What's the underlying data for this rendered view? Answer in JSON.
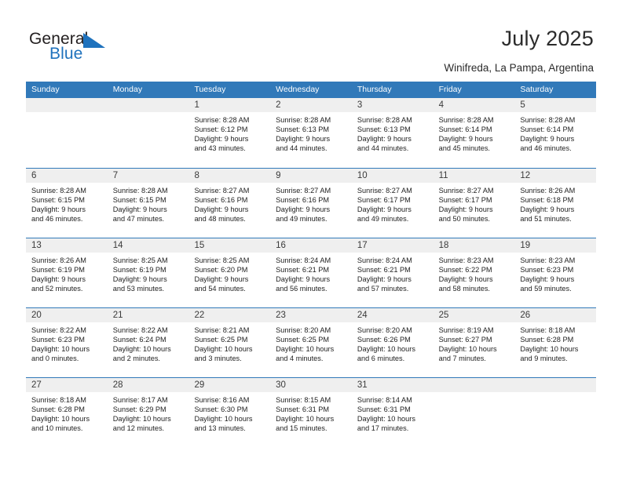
{
  "brand": {
    "name_part1": "General",
    "name_part2": "Blue",
    "flag_icon": "blue-triangle-flag-icon",
    "accent_color": "#1f72bd"
  },
  "header": {
    "title": "July 2025",
    "subtitle": "Winifreda, La Pampa, Argentina"
  },
  "theme": {
    "header_blue": "#3179b9",
    "day_band_gray": "#efefef",
    "text": "#222222"
  },
  "weekdays": [
    "Sunday",
    "Monday",
    "Tuesday",
    "Wednesday",
    "Thursday",
    "Friday",
    "Saturday"
  ],
  "weeks": [
    [
      {
        "day": "",
        "lines": []
      },
      {
        "day": "",
        "lines": []
      },
      {
        "day": "1",
        "lines": [
          "Sunrise: 8:28 AM",
          "Sunset: 6:12 PM",
          "Daylight: 9 hours",
          "and 43 minutes."
        ]
      },
      {
        "day": "2",
        "lines": [
          "Sunrise: 8:28 AM",
          "Sunset: 6:13 PM",
          "Daylight: 9 hours",
          "and 44 minutes."
        ]
      },
      {
        "day": "3",
        "lines": [
          "Sunrise: 8:28 AM",
          "Sunset: 6:13 PM",
          "Daylight: 9 hours",
          "and 44 minutes."
        ]
      },
      {
        "day": "4",
        "lines": [
          "Sunrise: 8:28 AM",
          "Sunset: 6:14 PM",
          "Daylight: 9 hours",
          "and 45 minutes."
        ]
      },
      {
        "day": "5",
        "lines": [
          "Sunrise: 8:28 AM",
          "Sunset: 6:14 PM",
          "Daylight: 9 hours",
          "and 46 minutes."
        ]
      }
    ],
    [
      {
        "day": "6",
        "lines": [
          "Sunrise: 8:28 AM",
          "Sunset: 6:15 PM",
          "Daylight: 9 hours",
          "and 46 minutes."
        ]
      },
      {
        "day": "7",
        "lines": [
          "Sunrise: 8:28 AM",
          "Sunset: 6:15 PM",
          "Daylight: 9 hours",
          "and 47 minutes."
        ]
      },
      {
        "day": "8",
        "lines": [
          "Sunrise: 8:27 AM",
          "Sunset: 6:16 PM",
          "Daylight: 9 hours",
          "and 48 minutes."
        ]
      },
      {
        "day": "9",
        "lines": [
          "Sunrise: 8:27 AM",
          "Sunset: 6:16 PM",
          "Daylight: 9 hours",
          "and 49 minutes."
        ]
      },
      {
        "day": "10",
        "lines": [
          "Sunrise: 8:27 AM",
          "Sunset: 6:17 PM",
          "Daylight: 9 hours",
          "and 49 minutes."
        ]
      },
      {
        "day": "11",
        "lines": [
          "Sunrise: 8:27 AM",
          "Sunset: 6:17 PM",
          "Daylight: 9 hours",
          "and 50 minutes."
        ]
      },
      {
        "day": "12",
        "lines": [
          "Sunrise: 8:26 AM",
          "Sunset: 6:18 PM",
          "Daylight: 9 hours",
          "and 51 minutes."
        ]
      }
    ],
    [
      {
        "day": "13",
        "lines": [
          "Sunrise: 8:26 AM",
          "Sunset: 6:19 PM",
          "Daylight: 9 hours",
          "and 52 minutes."
        ]
      },
      {
        "day": "14",
        "lines": [
          "Sunrise: 8:25 AM",
          "Sunset: 6:19 PM",
          "Daylight: 9 hours",
          "and 53 minutes."
        ]
      },
      {
        "day": "15",
        "lines": [
          "Sunrise: 8:25 AM",
          "Sunset: 6:20 PM",
          "Daylight: 9 hours",
          "and 54 minutes."
        ]
      },
      {
        "day": "16",
        "lines": [
          "Sunrise: 8:24 AM",
          "Sunset: 6:21 PM",
          "Daylight: 9 hours",
          "and 56 minutes."
        ]
      },
      {
        "day": "17",
        "lines": [
          "Sunrise: 8:24 AM",
          "Sunset: 6:21 PM",
          "Daylight: 9 hours",
          "and 57 minutes."
        ]
      },
      {
        "day": "18",
        "lines": [
          "Sunrise: 8:23 AM",
          "Sunset: 6:22 PM",
          "Daylight: 9 hours",
          "and 58 minutes."
        ]
      },
      {
        "day": "19",
        "lines": [
          "Sunrise: 8:23 AM",
          "Sunset: 6:23 PM",
          "Daylight: 9 hours",
          "and 59 minutes."
        ]
      }
    ],
    [
      {
        "day": "20",
        "lines": [
          "Sunrise: 8:22 AM",
          "Sunset: 6:23 PM",
          "Daylight: 10 hours",
          "and 0 minutes."
        ]
      },
      {
        "day": "21",
        "lines": [
          "Sunrise: 8:22 AM",
          "Sunset: 6:24 PM",
          "Daylight: 10 hours",
          "and 2 minutes."
        ]
      },
      {
        "day": "22",
        "lines": [
          "Sunrise: 8:21 AM",
          "Sunset: 6:25 PM",
          "Daylight: 10 hours",
          "and 3 minutes."
        ]
      },
      {
        "day": "23",
        "lines": [
          "Sunrise: 8:20 AM",
          "Sunset: 6:25 PM",
          "Daylight: 10 hours",
          "and 4 minutes."
        ]
      },
      {
        "day": "24",
        "lines": [
          "Sunrise: 8:20 AM",
          "Sunset: 6:26 PM",
          "Daylight: 10 hours",
          "and 6 minutes."
        ]
      },
      {
        "day": "25",
        "lines": [
          "Sunrise: 8:19 AM",
          "Sunset: 6:27 PM",
          "Daylight: 10 hours",
          "and 7 minutes."
        ]
      },
      {
        "day": "26",
        "lines": [
          "Sunrise: 8:18 AM",
          "Sunset: 6:28 PM",
          "Daylight: 10 hours",
          "and 9 minutes."
        ]
      }
    ],
    [
      {
        "day": "27",
        "lines": [
          "Sunrise: 8:18 AM",
          "Sunset: 6:28 PM",
          "Daylight: 10 hours",
          "and 10 minutes."
        ]
      },
      {
        "day": "28",
        "lines": [
          "Sunrise: 8:17 AM",
          "Sunset: 6:29 PM",
          "Daylight: 10 hours",
          "and 12 minutes."
        ]
      },
      {
        "day": "29",
        "lines": [
          "Sunrise: 8:16 AM",
          "Sunset: 6:30 PM",
          "Daylight: 10 hours",
          "and 13 minutes."
        ]
      },
      {
        "day": "30",
        "lines": [
          "Sunrise: 8:15 AM",
          "Sunset: 6:31 PM",
          "Daylight: 10 hours",
          "and 15 minutes."
        ]
      },
      {
        "day": "31",
        "lines": [
          "Sunrise: 8:14 AM",
          "Sunset: 6:31 PM",
          "Daylight: 10 hours",
          "and 17 minutes."
        ]
      },
      {
        "day": "",
        "lines": []
      },
      {
        "day": "",
        "lines": []
      }
    ]
  ]
}
